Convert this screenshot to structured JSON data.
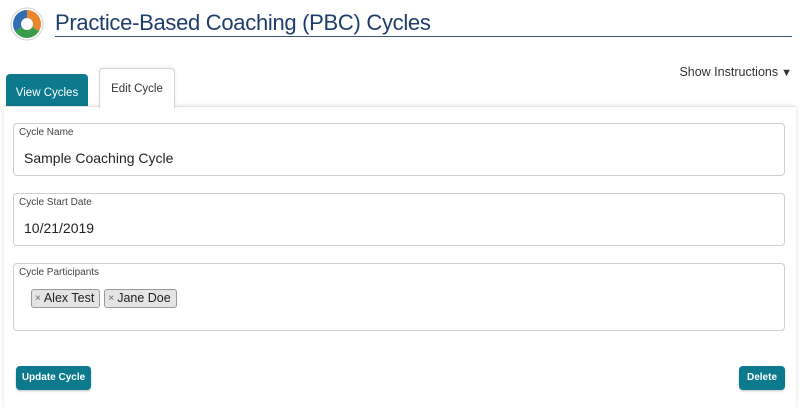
{
  "header": {
    "title": "Practice-Based Coaching (PBC) Cycles"
  },
  "instructions": {
    "label": "Show Instructions",
    "caret": "▼"
  },
  "tabs": [
    {
      "label": "View Cycles",
      "active": false
    },
    {
      "label": "Edit Cycle",
      "active": true
    }
  ],
  "form": {
    "cycle_name": {
      "label": "Cycle Name",
      "value": "Sample Coaching Cycle"
    },
    "start_date": {
      "label": "Cycle Start Date",
      "value": "10/21/2019"
    },
    "participants": {
      "label": "Cycle Participants",
      "items": [
        {
          "remove": "×",
          "name": "Alex Test"
        },
        {
          "remove": "×",
          "name": "Jane Doe"
        }
      ]
    }
  },
  "buttons": {
    "update": "Update Cycle",
    "delete": "Delete"
  },
  "colors": {
    "accent": "#0c7a8c",
    "title": "#1f3d6b"
  }
}
